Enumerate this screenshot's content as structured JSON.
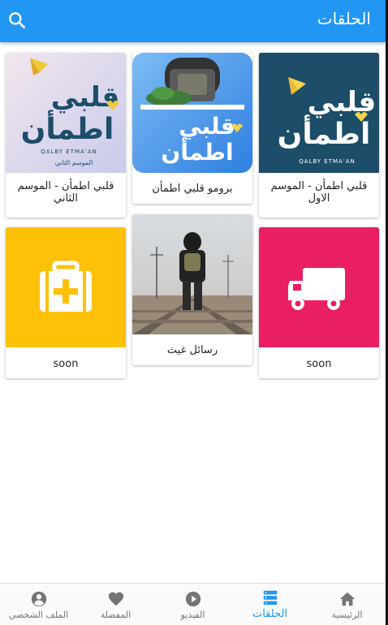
{
  "app_bar": {
    "title": "الحلقات",
    "color": "#2196f3"
  },
  "search": {
    "icon": "search-icon"
  },
  "episodes": [
    {
      "label": "قلبي اطمأن - الموسم الاول",
      "image": "qalby-etmaan-season1-cover",
      "logo_caption": "QALBY ETMA'AN"
    },
    {
      "label": "برومو قلبي اطمأن",
      "image": "qalby-etmaan-promo-cover",
      "logo_caption": ""
    },
    {
      "label": "قلبي اطمأن - الموسم الثاني",
      "image": "qalby-etmaan-season2-cover",
      "logo_caption": "QALBY ETMA'AN",
      "sub_caption": "الموسم الثاني"
    },
    {
      "label": "soon",
      "image": "truck-icon",
      "tile_color": "#e91e63"
    },
    {
      "label": "رسائل غيث",
      "image": "man-on-railway-photo"
    },
    {
      "label": "soon",
      "image": "medical-kit-icon",
      "tile_color": "#ffc107"
    }
  ],
  "logo_text": {
    "line1": "قلبي",
    "line2": "اطمأن"
  },
  "bottom_nav": {
    "items": [
      {
        "label": "الرئيسية",
        "icon": "home-icon"
      },
      {
        "label": "الحلقات",
        "icon": "episodes-icon",
        "active": true
      },
      {
        "label": "الفيديو",
        "icon": "play-icon"
      },
      {
        "label": "المفضلة",
        "icon": "heart-icon"
      },
      {
        "label": "الملف الشخصي",
        "icon": "profile-icon"
      }
    ],
    "active_color": "#2196f3",
    "inactive_color": "#757575"
  }
}
